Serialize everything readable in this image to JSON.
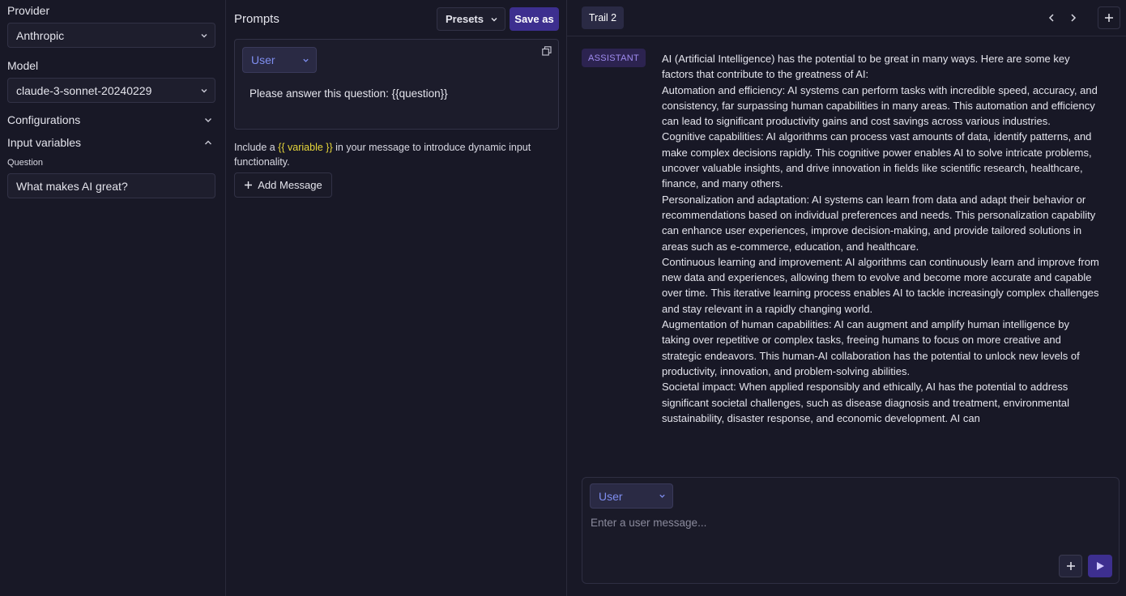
{
  "left": {
    "provider_label": "Provider",
    "provider_value": "Anthropic",
    "model_label": "Model",
    "model_value": "claude-3-sonnet-20240229",
    "configurations_label": "Configurations",
    "input_variables_label": "Input variables",
    "question_label": "Question",
    "question_value": "What makes AI great?"
  },
  "prompts": {
    "title": "Prompts",
    "presets_label": "Presets",
    "save_as_label": "Save as",
    "role": "User",
    "message": "Please answer this question: {{question}}",
    "hint_prefix": "Include a ",
    "hint_variable": "{{ variable }}",
    "hint_suffix": " in your message to introduce dynamic input functionality.",
    "add_message_label": "Add Message"
  },
  "trail": {
    "title": "Trail 2",
    "role_badge": "ASSISTANT",
    "intro": "AI (Artificial Intelligence) has the potential to be great in many ways. Here are some key factors that contribute to the greatness of AI:",
    "items": [
      "Automation and efficiency: AI systems can perform tasks with incredible speed, accuracy, and consistency, far surpassing human capabilities in many areas. This automation and efficiency can lead to significant productivity gains and cost savings across various industries.",
      "Cognitive capabilities: AI algorithms can process vast amounts of data, identify patterns, and make complex decisions rapidly. This cognitive power enables AI to solve intricate problems, uncover valuable insights, and drive innovation in fields like scientific research, healthcare, finance, and many others.",
      "Personalization and adaptation: AI systems can learn from data and adapt their behavior or recommendations based on individual preferences and needs. This personalization capability can enhance user experiences, improve decision-making, and provide tailored solutions in areas such as e-commerce, education, and healthcare.",
      "Continuous learning and improvement: AI algorithms can continuously learn and improve from new data and experiences, allowing them to evolve and become more accurate and capable over time. This iterative learning process enables AI to tackle increasingly complex challenges and stay relevant in a rapidly changing world.",
      "Augmentation of human capabilities: AI can augment and amplify human intelligence by taking over repetitive or complex tasks, freeing humans to focus on more creative and strategic endeavors. This human-AI collaboration has the potential to unlock new levels of productivity, innovation, and problem-solving abilities.",
      "Societal impact: When applied responsibly and ethically, AI has the potential to address significant societal challenges, such as disease diagnosis and treatment, environmental sustainability, disaster response, and economic development. AI can"
    ],
    "composer_role": "User",
    "composer_placeholder": "Enter a user message..."
  },
  "colors": {
    "background": "#181826",
    "accent": "#3d2f8f",
    "badge_bg": "#2c2350",
    "badge_text": "#a08cf0",
    "role_text": "#7f8ef0",
    "variable_highlight": "#e6d63a"
  },
  "icons": {
    "chevron_down": "chevron-down-icon",
    "chevron_up": "chevron-up-icon",
    "copy": "copy-icon",
    "plus": "plus-icon",
    "prev": "chevron-left-icon",
    "next": "chevron-right-icon",
    "send": "play-icon"
  }
}
